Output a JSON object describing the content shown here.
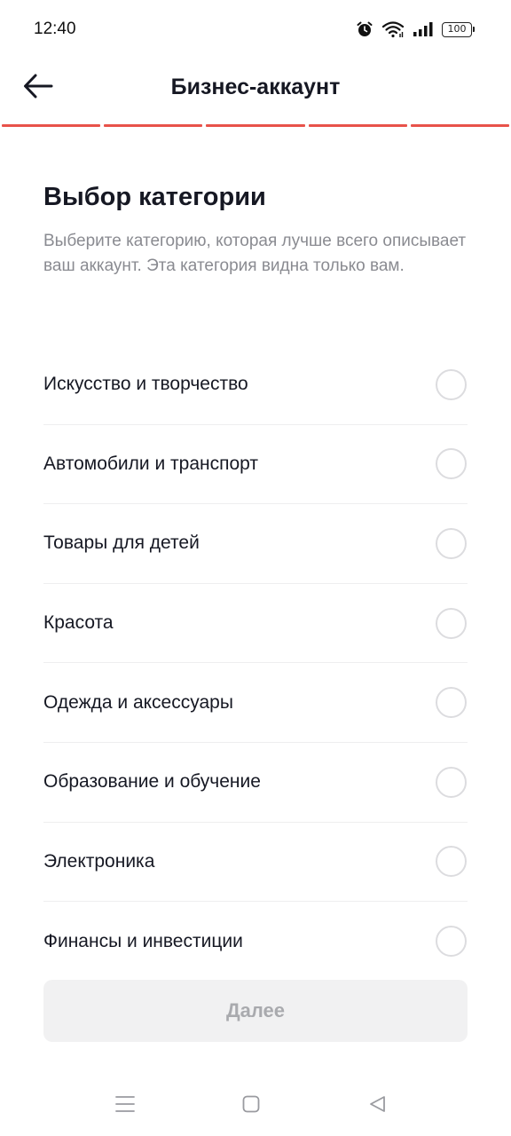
{
  "status_bar": {
    "time": "12:40",
    "battery": "100",
    "icons": [
      "alarm-icon",
      "wifi-icon",
      "signal-icon",
      "battery-icon"
    ]
  },
  "header": {
    "title": "Бизнес-аккаунт",
    "back_icon": "arrow-left-icon"
  },
  "progress": {
    "steps_total": 5,
    "steps_filled": 5,
    "color": "#e8524a"
  },
  "main": {
    "title": "Выбор категории",
    "description": "Выберите категорию, которая лучше всего описывает ваш аккаунт. Эта категория видна только вам.",
    "categories": [
      {
        "label": "Искусство и творчество",
        "selected": false
      },
      {
        "label": "Автомобили и транспорт",
        "selected": false
      },
      {
        "label": "Товары для детей",
        "selected": false
      },
      {
        "label": "Красота",
        "selected": false
      },
      {
        "label": "Одежда и аксессуары",
        "selected": false
      },
      {
        "label": "Образование и обучение",
        "selected": false
      },
      {
        "label": "Электроника",
        "selected": false
      },
      {
        "label": "Финансы и инвестиции",
        "selected": false
      }
    ],
    "next_label": "Далее"
  },
  "nav_bar": {
    "icons": [
      "menu-icon",
      "home-square-icon",
      "back-triangle-icon"
    ]
  }
}
